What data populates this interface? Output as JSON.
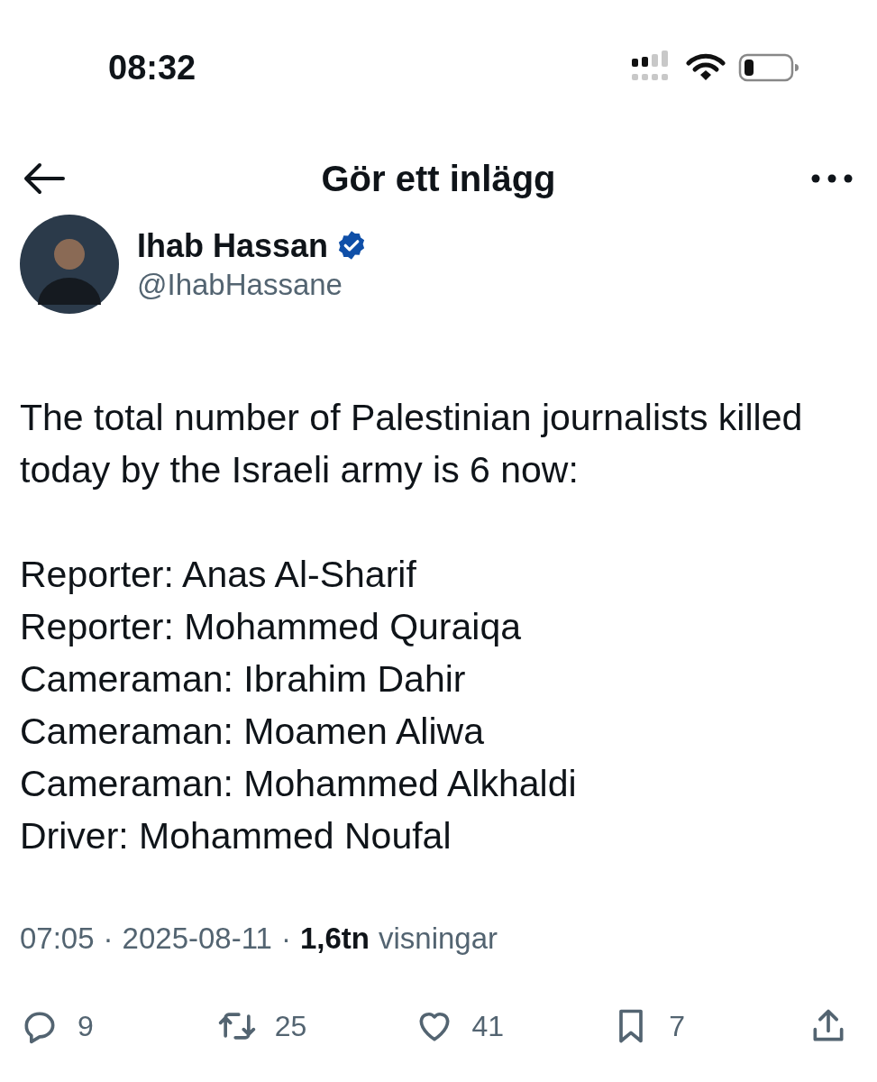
{
  "status_bar": {
    "time": "08:32"
  },
  "header": {
    "title": "Gör ett inlägg"
  },
  "post": {
    "author": {
      "name": "Ihab Hassan",
      "verified": true,
      "handle": "@IhabHassane"
    },
    "paragraphs": [
      "The total number of Palestinian journalists killed today by the Israeli army is 6 now:"
    ],
    "lines": [
      "Reporter: Anas Al-Sharif",
      "Reporter: Mohammed Quraiqa",
      "Cameraman: Ibrahim Dahir",
      "Cameraman: Moamen Aliwa",
      "Cameraman: Mohammed Alkhaldi",
      "Driver: Mohammed Noufal"
    ],
    "meta": {
      "time": "07:05",
      "separator_1": "·",
      "date": "2025-08-11",
      "separator_2": "·",
      "views_count": "1,6tn",
      "views_label": "visningar"
    },
    "actions": [
      {
        "kind": "reply",
        "count": "9"
      },
      {
        "kind": "repost",
        "count": "25"
      },
      {
        "kind": "like",
        "count": "41"
      },
      {
        "kind": "bookmark",
        "count": "7"
      },
      {
        "kind": "share"
      }
    ]
  }
}
